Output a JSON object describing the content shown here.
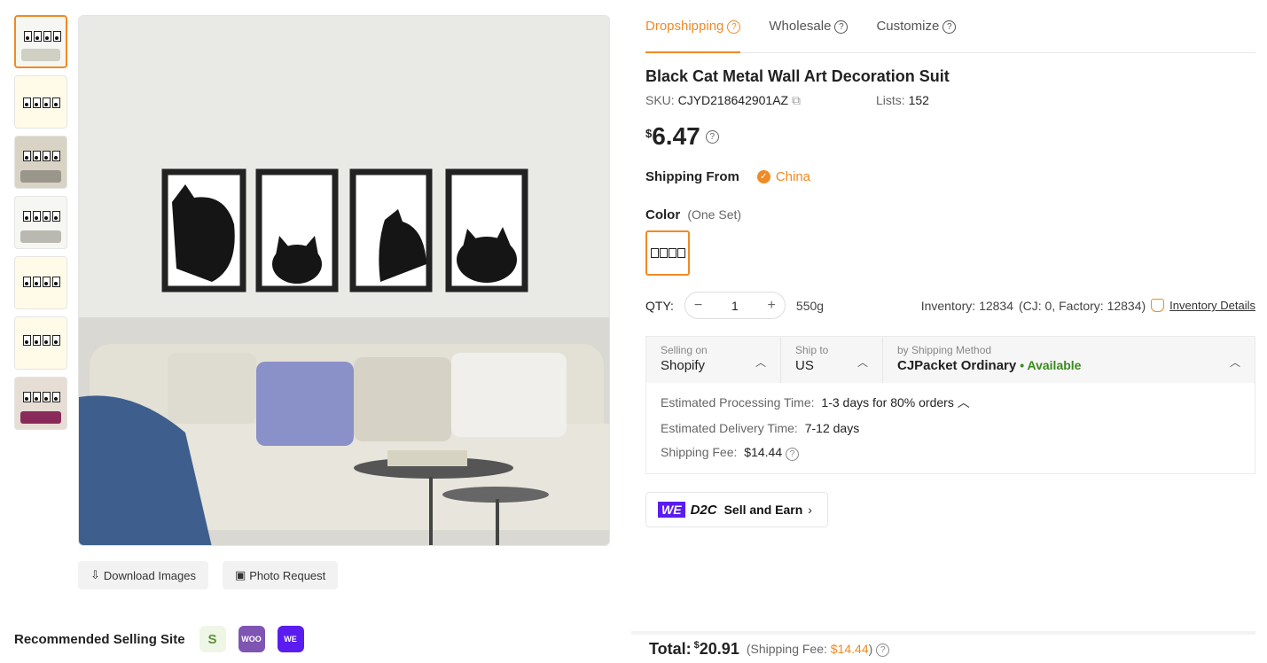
{
  "tabs": [
    {
      "label": "Dropshipping",
      "active": true
    },
    {
      "label": "Wholesale",
      "active": false
    },
    {
      "label": "Customize",
      "active": false
    }
  ],
  "product": {
    "title": "Black Cat Metal Wall Art Decoration Suit",
    "sku_label": "SKU:",
    "sku": "CJYD218642901AZ",
    "lists_label": "Lists:",
    "lists": "152",
    "price_currency": "$",
    "price": "6.47"
  },
  "shipping_from": {
    "label": "Shipping From",
    "value": "China"
  },
  "color": {
    "label": "Color",
    "value": "(One Set)"
  },
  "qty": {
    "label": "QTY:",
    "value": "1",
    "minus": "−",
    "plus": "+",
    "weight": "550g"
  },
  "inventory": {
    "text": "Inventory: 12834",
    "breakdown": "(CJ: 0, Factory: 12834)",
    "details_link": "Inventory Details"
  },
  "shipping": {
    "selling_on_label": "Selling on",
    "selling_on": "Shopify",
    "ship_to_label": "Ship to",
    "ship_to": "US",
    "method_label": "by Shipping Method",
    "method": "CJPacket Ordinary",
    "availability": "• Available",
    "processing_label": "Estimated Processing Time:",
    "processing": "1-3 days for 80% orders",
    "delivery_label": "Estimated Delivery Time:",
    "delivery": "7-12 days",
    "fee_label": "Shipping Fee:",
    "fee": "$14.44"
  },
  "d2c": {
    "we": "WE",
    "d2c": "D2C",
    "label": "Sell and Earn"
  },
  "image_buttons": {
    "download": "Download Images",
    "photo_request": "Photo Request"
  },
  "recommended": {
    "label": "Recommended Selling Site",
    "sites": [
      "Shopify",
      "WOO",
      "WE D2C"
    ]
  },
  "total": {
    "label": "Total:",
    "currency": "$",
    "value": "20.91",
    "fee_prefix": "(Shipping Fee:",
    "fee": "$14.44",
    "fee_suffix": ")"
  },
  "colors": {
    "accent": "#f08a24",
    "available": "#3a8a1e",
    "we_purple": "#5b1cf0"
  }
}
